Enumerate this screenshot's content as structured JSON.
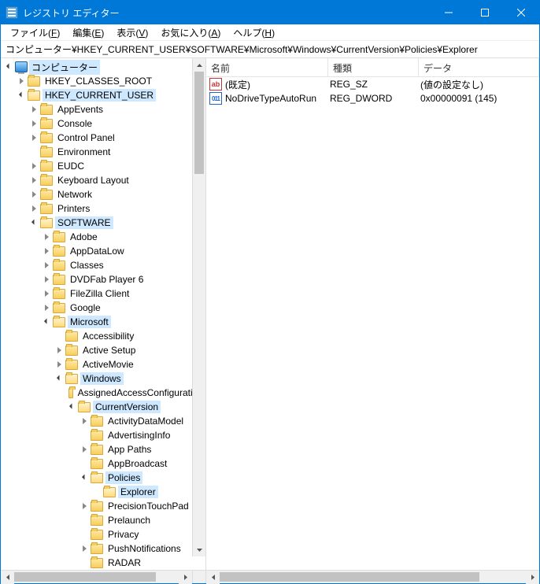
{
  "window": {
    "title": "レジストリ エディター"
  },
  "menu": {
    "file": "ファイル(",
    "file_u": "F",
    "file_end": ")",
    "edit": "編集(",
    "edit_u": "E",
    "edit_end": ")",
    "view": "表示(",
    "view_u": "V",
    "view_end": ")",
    "fav": "お気に入り(",
    "fav_u": "A",
    "fav_end": ")",
    "help": "ヘルプ(",
    "help_u": "H",
    "help_end": ")"
  },
  "address": "コンピューター¥HKEY_CURRENT_USER¥SOFTWARE¥Microsoft¥Windows¥CurrentVersion¥Policies¥Explorer",
  "tree": {
    "root": "コンピューター",
    "hkcr": "HKEY_CLASSES_ROOT",
    "hkcu": "HKEY_CURRENT_USER",
    "appevents": "AppEvents",
    "console": "Console",
    "controlpanel": "Control Panel",
    "environment": "Environment",
    "eudc": "EUDC",
    "keyboard": "Keyboard Layout",
    "network": "Network",
    "printers": "Printers",
    "software": "SOFTWARE",
    "adobe": "Adobe",
    "appdatalow": "AppDataLow",
    "classes": "Classes",
    "dvdfab": "DVDFab Player 6",
    "filezilla": "FileZilla Client",
    "google": "Google",
    "microsoft": "Microsoft",
    "accessibility": "Accessibility",
    "activesetup": "Active Setup",
    "activemovie": "ActiveMovie",
    "windows": "Windows",
    "assignedaccess": "AssignedAccessConfiguration",
    "currentversion": "CurrentVersion",
    "activitydata": "ActivityDataModel",
    "advertising": "AdvertisingInfo",
    "apppaths": "App Paths",
    "appbroadcast": "AppBroadcast",
    "policies": "Policies",
    "explorer": "Explorer",
    "precisiontouchpad": "PrecisionTouchPad",
    "prelaunch": "Prelaunch",
    "privacy": "Privacy",
    "pushnotifications": "PushNotifications",
    "radar": "RADAR"
  },
  "list": {
    "col_name": "名前",
    "col_type": "種類",
    "col_data": "データ",
    "rows": [
      {
        "name": "(既定)",
        "type": "REG_SZ",
        "data": "(値の設定なし)",
        "icon": "str"
      },
      {
        "name": "NoDriveTypeAutoRun",
        "type": "REG_DWORD",
        "data": "0x00000091 (145)",
        "icon": "dword"
      }
    ]
  }
}
